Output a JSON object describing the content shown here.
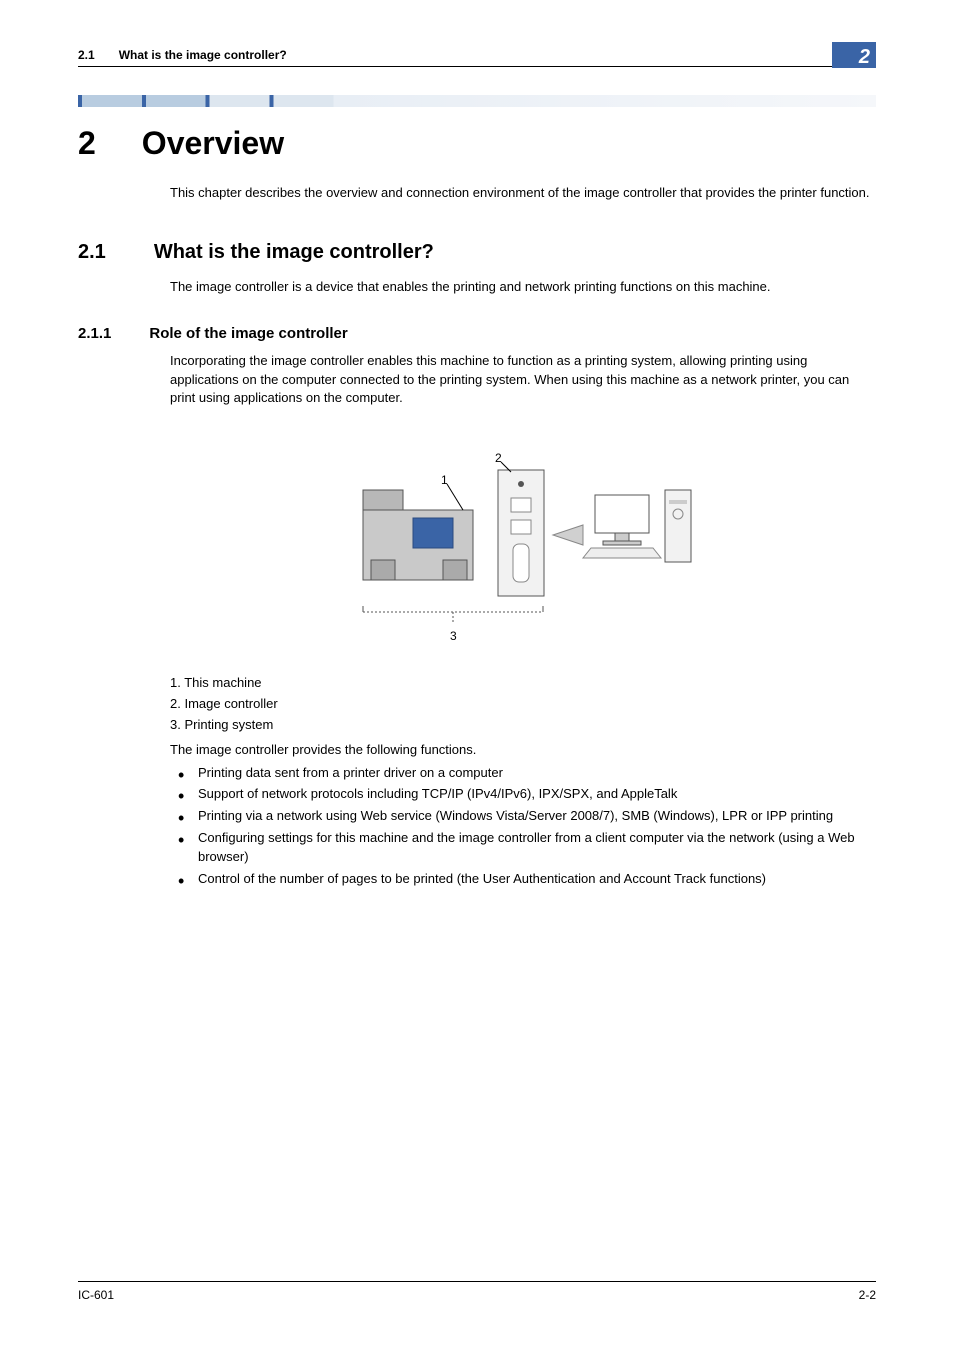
{
  "header": {
    "section_number": "2.1",
    "section_title": "What is the image controller?",
    "badge": "2"
  },
  "chapter": {
    "number": "2",
    "title": "Overview",
    "intro": "This chapter describes the overview and connection environment of the image controller that provides the printer function."
  },
  "section": {
    "number": "2.1",
    "title": "What is the image controller?",
    "text": "The image controller is a device that enables the printing and network printing functions on this machine."
  },
  "subsection": {
    "number": "2.1.1",
    "title": "Role of the image controller",
    "text": "Incorporating the image controller enables this machine to function as a printing system, allowing printing using applications on the computer connected to the printing system. When using this machine as a network printer, you can print using applications on the computer."
  },
  "diagram": {
    "labels": {
      "l1": "1",
      "l2": "2",
      "l3": "3"
    },
    "legend": {
      "i1": "1. This machine",
      "i2": "2. Image controller",
      "i3": "3. Printing system"
    }
  },
  "functions": {
    "intro": "The image controller provides the following functions.",
    "items": [
      "Printing data sent from a printer driver on a computer",
      "Support of network protocols including TCP/IP (IPv4/IPv6), IPX/SPX, and AppleTalk",
      "Printing via a network using Web service (Windows Vista/Server 2008/7), SMB (Windows), LPR or IPP printing",
      "Configuring settings for this machine and the image controller from a client computer via the network (using a Web browser)",
      "Control of the number of pages to be printed (the User Authentication and Account Track functions)"
    ]
  },
  "footer": {
    "left": "IC-601",
    "right": "2-2"
  }
}
